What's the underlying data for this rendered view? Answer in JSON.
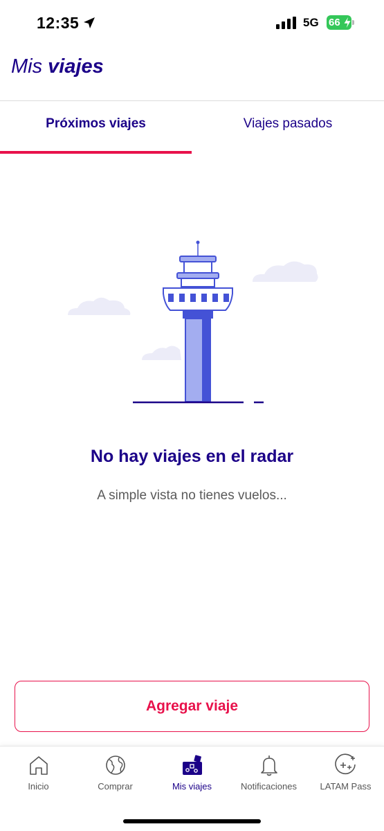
{
  "status_bar": {
    "time": "12:35",
    "network": "5G",
    "battery": "66"
  },
  "header": {
    "title_light": "Mis",
    "title_bold": "viajes"
  },
  "tabs": [
    {
      "label": "Próximos viajes",
      "active": true
    },
    {
      "label": "Viajes pasados",
      "active": false
    }
  ],
  "empty_state": {
    "title": "No hay viajes en el radar",
    "subtitle": "A simple vista no tienes vuelos...",
    "illustration": "control-tower-icon"
  },
  "add_trip_button": {
    "label": "Agregar viaje"
  },
  "bottom_nav": {
    "items": [
      {
        "label": "Inicio",
        "icon": "home-icon"
      },
      {
        "label": "Comprar",
        "icon": "globe-icon"
      },
      {
        "label": "Mis viajes",
        "icon": "suitcase-icon",
        "active": true
      },
      {
        "label": "Notificaciones",
        "icon": "bell-icon"
      },
      {
        "label": "LATAM Pass",
        "icon": "sparkle-icon"
      }
    ]
  },
  "colors": {
    "brand_navy": "#1b0088",
    "accent_red": "#e8114b",
    "illustration_blue": "#4452d6",
    "illustration_light": "#a3adf0"
  }
}
